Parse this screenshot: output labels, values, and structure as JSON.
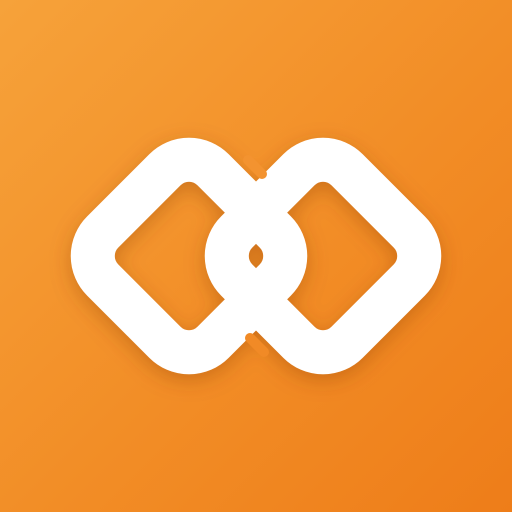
{
  "app_icon": {
    "icon": "chain-link-icon",
    "colors": {
      "background_top_left": "#f6a23a",
      "background_bottom_right": "#ee7d19",
      "mark": "#ffffff"
    }
  }
}
